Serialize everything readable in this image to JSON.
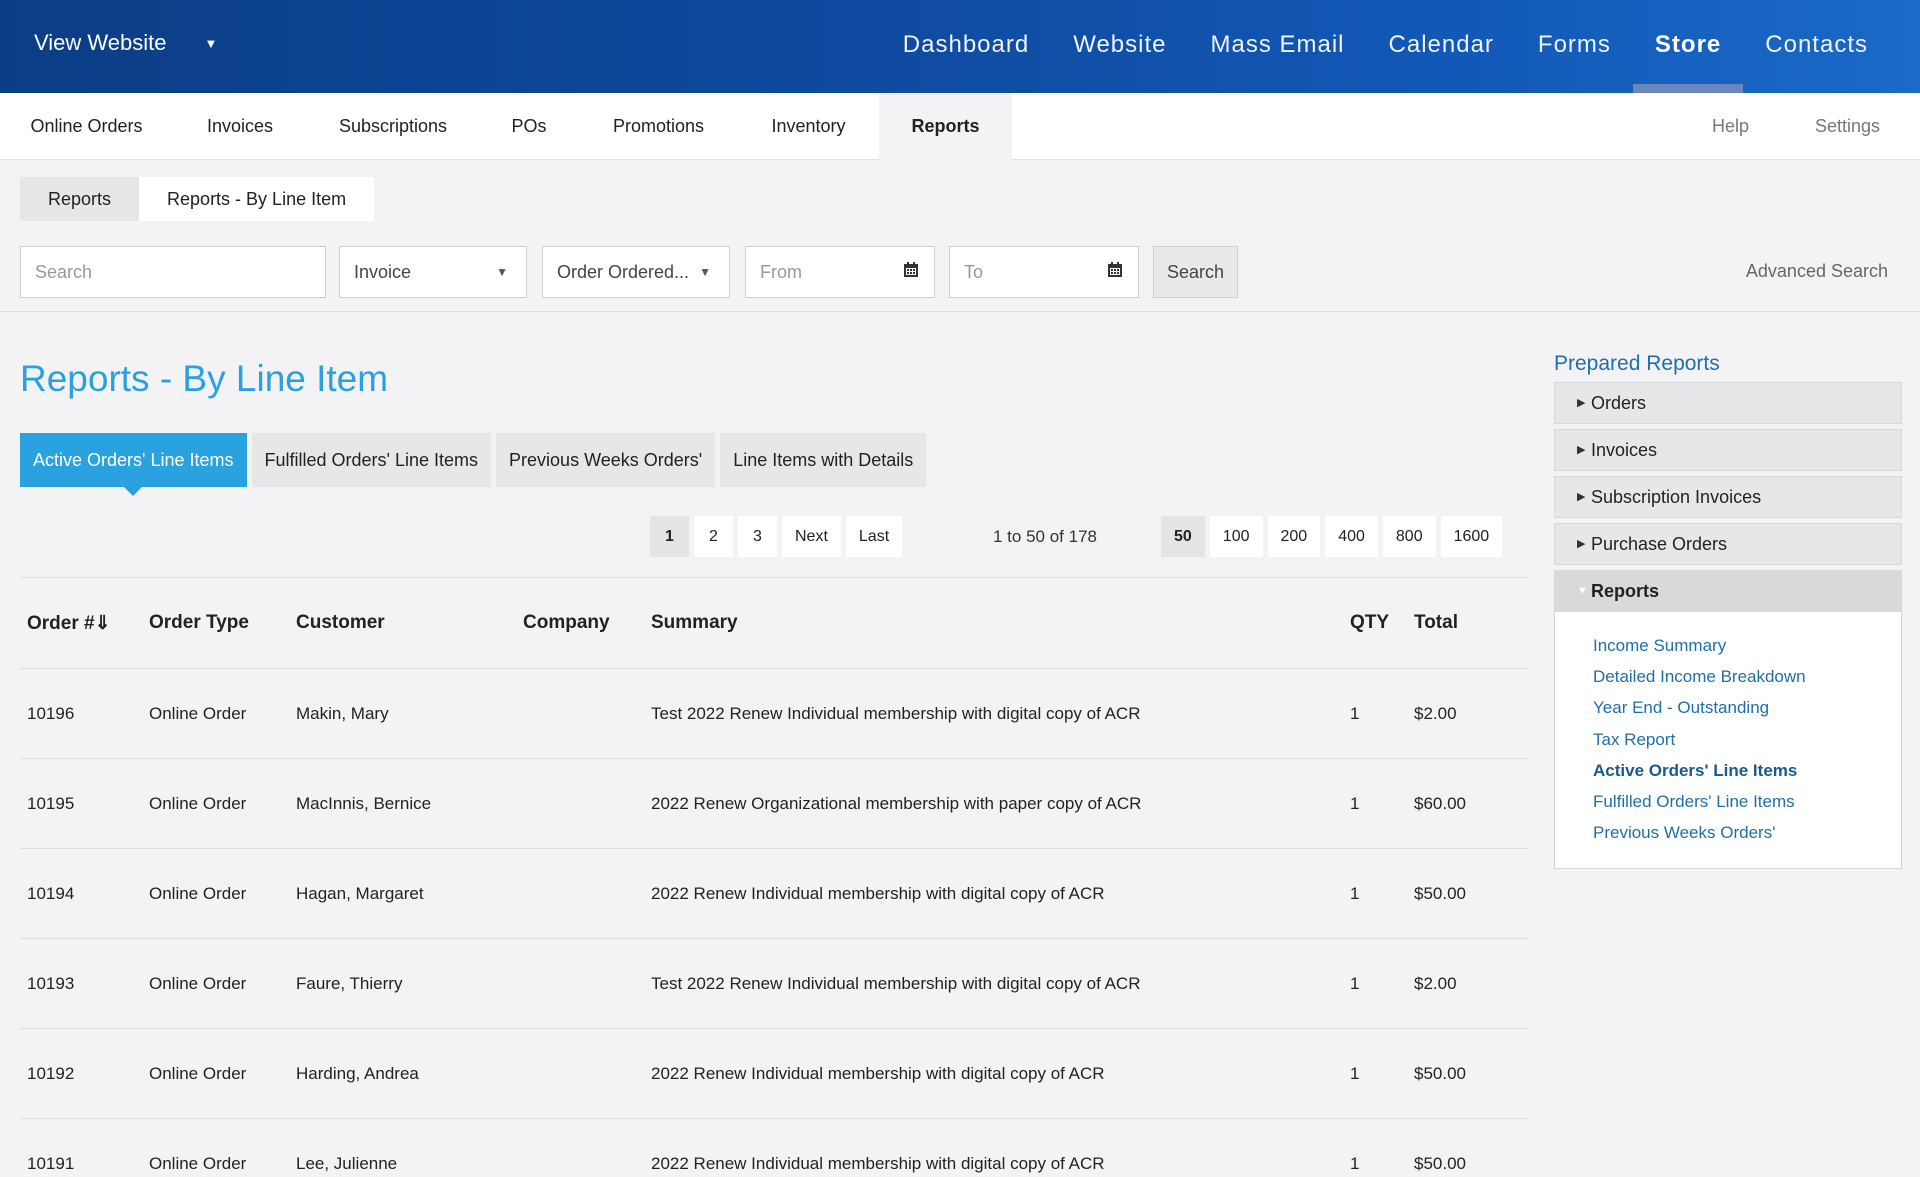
{
  "topbar": {
    "view_website": "View Website",
    "nav": [
      "Dashboard",
      "Website",
      "Mass Email",
      "Calendar",
      "Forms",
      "Store",
      "Contacts"
    ],
    "active_nav": "Store"
  },
  "subnav": {
    "items": [
      "Online Orders",
      "Invoices",
      "Subscriptions",
      "POs",
      "Promotions",
      "Inventory",
      "Reports"
    ],
    "right": [
      "Help",
      "Settings"
    ]
  },
  "breadcrumb": [
    "Reports",
    "Reports - By Line Item"
  ],
  "search": {
    "placeholder": "Search",
    "type_select": "Invoice",
    "order_select": "Order Ordered...",
    "from_placeholder": "From",
    "to_placeholder": "To",
    "button": "Search",
    "advanced": "Advanced Search"
  },
  "page_title": "Reports - By Line Item",
  "report_tabs": [
    "Active Orders' Line Items",
    "Fulfilled Orders' Line Items",
    "Previous Weeks Orders'",
    "Line Items with Details"
  ],
  "pagination": {
    "pages": [
      "1",
      "2",
      "3",
      "Next",
      "Last"
    ],
    "range": "1 to 50 of 178",
    "sizes": [
      "50",
      "100",
      "200",
      "400",
      "800",
      "1600"
    ]
  },
  "table": {
    "headers": [
      "Order #⇓",
      "Order Type",
      "Customer",
      "Company",
      "Summary",
      "QTY",
      "Total"
    ],
    "rows": [
      [
        "10196",
        "Online Order",
        "Makin, Mary",
        "",
        "Test 2022 Renew Individual membership with digital copy of ACR",
        "1",
        "$2.00"
      ],
      [
        "10195",
        "Online Order",
        "MacInnis, Bernice",
        "",
        "2022 Renew Organizational membership with paper copy of ACR",
        "1",
        "$60.00"
      ],
      [
        "10194",
        "Online Order",
        "Hagan, Margaret",
        "",
        "2022 Renew Individual membership with digital copy of ACR",
        "1",
        "$50.00"
      ],
      [
        "10193",
        "Online Order",
        "Faure, Thierry",
        "",
        "Test 2022 Renew Individual membership with digital copy of ACR",
        "1",
        "$2.00"
      ],
      [
        "10192",
        "Online Order",
        "Harding, Andrea",
        "",
        "2022 Renew Individual membership with digital copy of ACR",
        "1",
        "$50.00"
      ],
      [
        "10191",
        "Online Order",
        "Lee, Julienne",
        "",
        "2022 Renew Individual membership with digital copy of ACR",
        "1",
        "$50.00"
      ]
    ]
  },
  "sidebar": {
    "title": "Prepared Reports",
    "sections": [
      "Orders",
      "Invoices",
      "Subscription Invoices",
      "Purchase Orders",
      "Reports"
    ],
    "links": [
      "Income Summary",
      "Detailed Income Breakdown",
      "Year End - Outstanding",
      "Tax Report",
      "Active Orders' Line Items",
      "Fulfilled Orders' Line Items",
      "Previous Weeks Orders'"
    ]
  }
}
